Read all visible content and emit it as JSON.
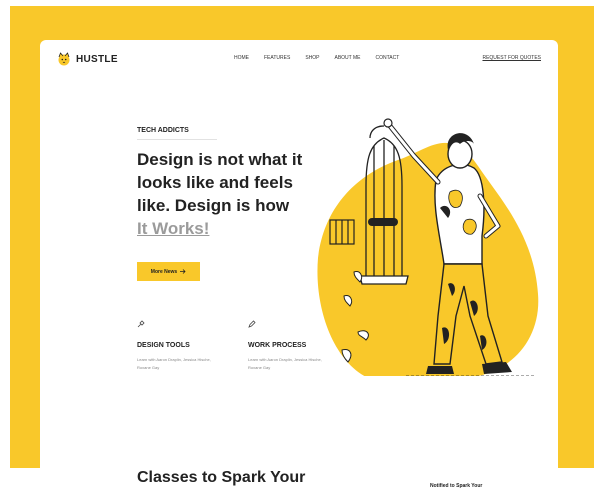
{
  "brand": {
    "name": "HUSTLE"
  },
  "nav": {
    "items": [
      {
        "label": "HOME"
      },
      {
        "label": "FEATURES"
      },
      {
        "label": "SHOP"
      },
      {
        "label": "ABOUT ME"
      },
      {
        "label": "CONTACT"
      }
    ],
    "cta": "REQUEST FOR QUOTES"
  },
  "hero": {
    "eyebrow": "TECH ADDICTS",
    "headline_line1": "Design is not what it",
    "headline_line2": "looks like and feels",
    "headline_line3": "like. Design is how",
    "headline_accent": "It Works!",
    "button_label": "More News",
    "button_icon": "arrow-right-icon"
  },
  "features": [
    {
      "icon": "brush-icon",
      "title": "DESIGN TOOLS",
      "text": "Learn with Aaron Draplin, Jessica Hische, Roxane Gay"
    },
    {
      "icon": "pen-icon",
      "title": "WORK PROCESS",
      "text": "Learn with Aaron Draplin, Jessica Hische, Roxane Gay"
    }
  ],
  "classes": {
    "title": "Classes to Spark Your",
    "side_note": "Notified to Spark Your"
  },
  "colors": {
    "accent": "#f9c82a",
    "text": "#222222",
    "muted": "#9b9b9b",
    "background": "#ffffff"
  }
}
